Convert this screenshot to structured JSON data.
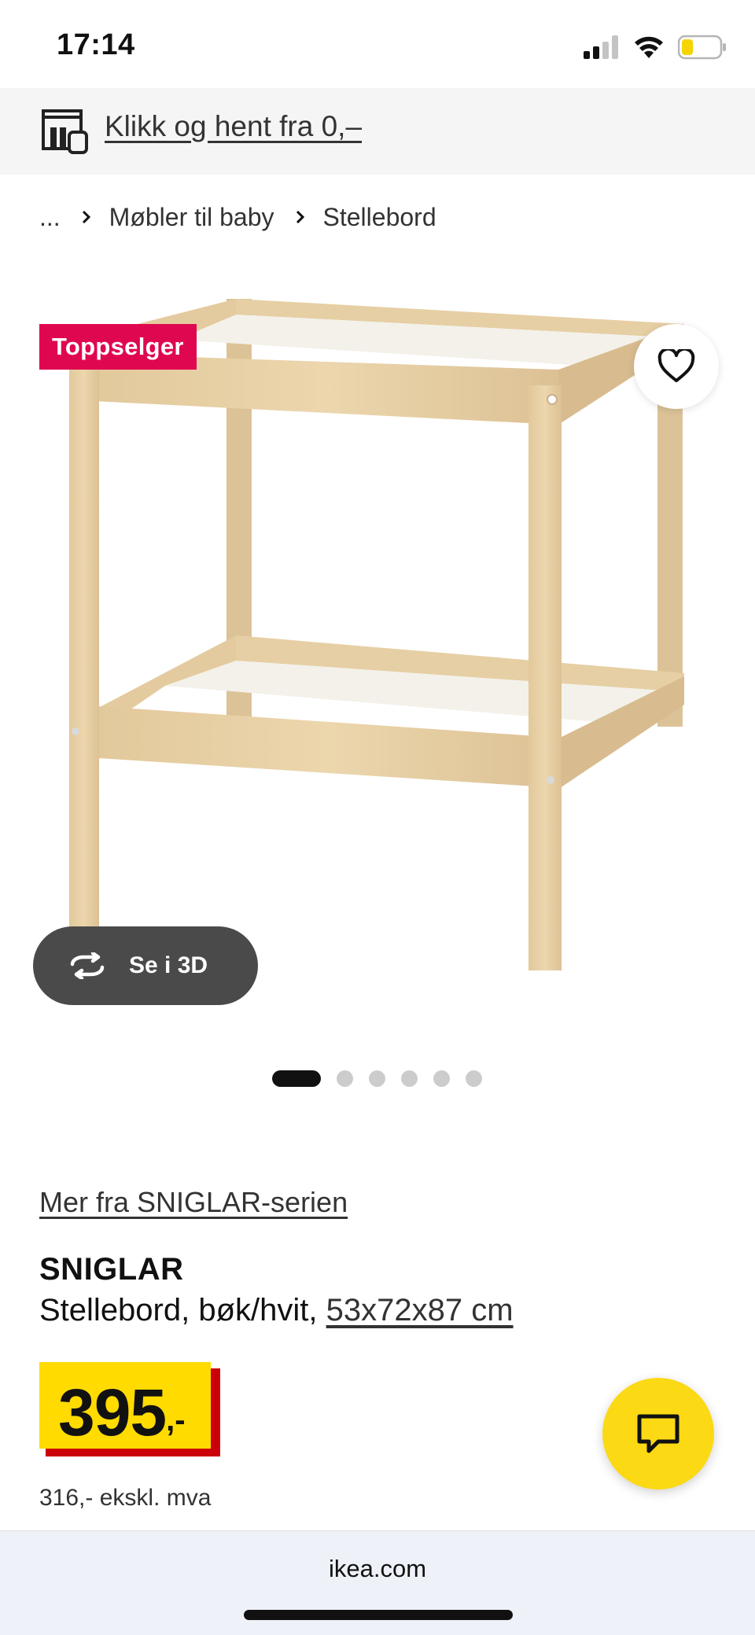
{
  "status_bar": {
    "time": "17:14"
  },
  "promo": {
    "text": "Klikk og hent fra 0,–"
  },
  "breadcrumb": {
    "ellipsis": "...",
    "items": [
      "Møbler til baby",
      "Stellebord"
    ]
  },
  "gallery": {
    "badge": "Toppselger",
    "view_3d_label": "Se i 3D",
    "image_count": 6,
    "active_index": 0
  },
  "product": {
    "series_link": "Mer fra SNIGLAR-serien",
    "name": "SNIGLAR",
    "description": "Stellebord, bøk/hvit,",
    "dimensions": "53x72x87 cm",
    "price_main": "395",
    "price_suffix": ",-",
    "price_excl_vat": "316,- ekskl. mva"
  },
  "browser": {
    "url": "ikea.com"
  },
  "colors": {
    "badge": "#e00751",
    "price_box": "#ffdb00",
    "price_shadow": "#cc0008",
    "chat_button": "#fbd914",
    "battery": "#f5d400"
  },
  "icons": [
    "signal-icon",
    "wifi-icon",
    "battery-icon",
    "store-icon",
    "chevron-right-icon",
    "heart-icon",
    "rotate-3d-icon",
    "chat-icon"
  ]
}
